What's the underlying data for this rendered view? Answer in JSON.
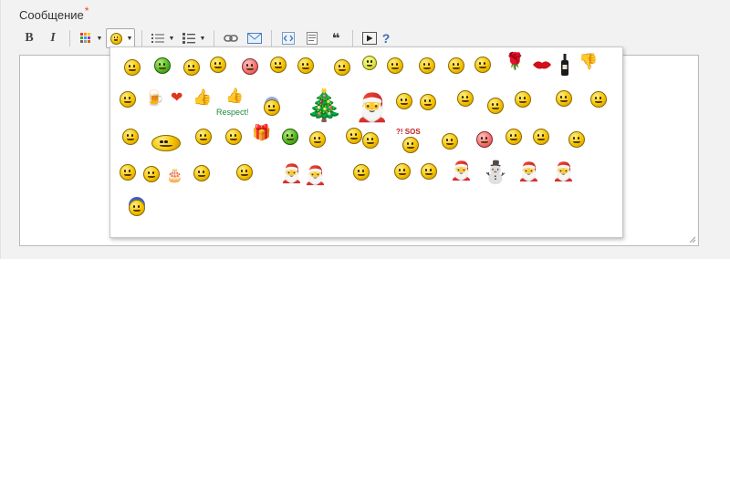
{
  "field": {
    "label": "Сообщение",
    "required_mark": "*"
  },
  "toolbar": {
    "bold": "B",
    "italic": "I",
    "help": "?"
  },
  "smiley_picker": {
    "respect_label": "Respect!",
    "sos_label": "SOS",
    "sos_prefix": "?!"
  },
  "icons": [
    "bold-icon",
    "italic-icon",
    "color-grid-icon",
    "smiley-icon",
    "bullet-list-icon",
    "numbered-list-icon",
    "link-icon",
    "email-icon",
    "code-icon",
    "text-block-icon",
    "quote-icon",
    "video-icon",
    "help-icon"
  ],
  "colors": {
    "panel_bg": "#f2f2f2",
    "required": "#e2541b",
    "help": "#3b6db3",
    "face": "#f5c400"
  }
}
